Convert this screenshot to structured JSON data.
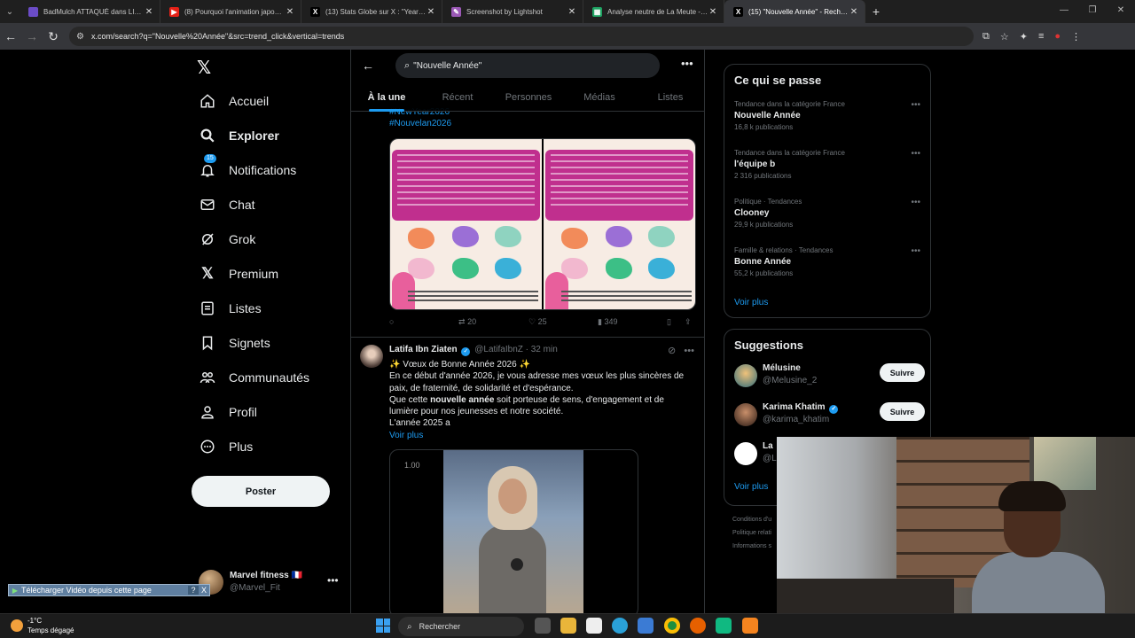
{
  "browser": {
    "tabs": [
      {
        "title": "BadMulch ATTAQUÉ dans LIBÉ",
        "color": "#6b4cc7",
        "glyph": ""
      },
      {
        "title": "(8) Pourquoi l'animation japonaise",
        "color": "#e62117",
        "glyph": "▶"
      },
      {
        "title": "(13) Stats Globe sur X : \"Year W",
        "color": "#000000",
        "glyph": "X"
      },
      {
        "title": "Screenshot by Lightshot",
        "color": "#9b59b6",
        "glyph": "✎"
      },
      {
        "title": "Analyse neutre de La Meute - G",
        "color": "#1ea362",
        "glyph": "▦"
      },
      {
        "title": "(15) \"Nouvelle Année\" - Recherche",
        "color": "#000000",
        "glyph": "X",
        "active": true
      }
    ],
    "new_tab": "+",
    "url": "x.com/search?q=\"Nouvelle%20Année\"&src=trend_click&vertical=trends"
  },
  "nav": {
    "items": [
      {
        "key": "home",
        "label": "Accueil"
      },
      {
        "key": "explore",
        "label": "Explorer"
      },
      {
        "key": "notifications",
        "label": "Notifications",
        "badge": "15"
      },
      {
        "key": "chat",
        "label": "Chat"
      },
      {
        "key": "grok",
        "label": "Grok"
      },
      {
        "key": "premium",
        "label": "Premium"
      },
      {
        "key": "lists",
        "label": "Listes"
      },
      {
        "key": "bookmarks",
        "label": "Signets"
      },
      {
        "key": "communities",
        "label": "Communautés"
      },
      {
        "key": "profile",
        "label": "Profil"
      },
      {
        "key": "more",
        "label": "Plus"
      }
    ],
    "post_label": "Poster",
    "account": {
      "name": "Marvel fitness 🇫🇷",
      "handle": "@Marvel_Fit"
    }
  },
  "search": {
    "query": "\"Nouvelle Année\"",
    "tabs": [
      "À la une",
      "Récent",
      "Personnes",
      "Médias",
      "Listes"
    ]
  },
  "tweet1": {
    "hashtags": [
      "#NewYear2026",
      "#Nouvelan2026"
    ],
    "actions": {
      "retweets": "20",
      "likes": "25",
      "views": "349"
    }
  },
  "tweet2": {
    "name": "Latifa Ibn Ziaten",
    "handle": "@LatifaIbnZ",
    "time": "· 32 min",
    "line1": "✨ Vœux de Bonne Année 2026 ✨",
    "line2": "En ce début d'année 2026, je vous adresse mes vœux les plus sincères de paix, de fraternité, de solidarité et d'espérance.",
    "line3_pre": "Que cette ",
    "line3_bold": "nouvelle année",
    "line3_post": " soit porteuse de sens, d'engagement et de lumière pour nos jeunesses et notre société.",
    "line4": "L'année 2025 a",
    "more": "Voir plus",
    "video_rate": "1.00"
  },
  "trends": {
    "title": "Ce qui se passe",
    "items": [
      {
        "context": "Tendance dans la catégorie France",
        "name": "Nouvelle Année",
        "count": "16,8 k publications"
      },
      {
        "context": "Tendance dans la catégorie France",
        "name": "l'équipe b",
        "count": "2 316 publications"
      },
      {
        "context": "Politique · Tendances",
        "name": "Clooney",
        "count": "29,9 k publications"
      },
      {
        "context": "Famille & relations · Tendances",
        "name": "Bonne Année",
        "count": "55,2 k publications"
      }
    ],
    "show_more": "Voir plus"
  },
  "suggestions": {
    "title": "Suggestions",
    "items": [
      {
        "name": "Mélusine",
        "handle": "@Melusine_2",
        "follow": "Suivre"
      },
      {
        "name": "Karima Khatim",
        "handle": "@karima_khatim",
        "follow": "Suivre"
      },
      {
        "name": "La",
        "handle": "@L"
      }
    ],
    "show_more": "Voir plus"
  },
  "legal": [
    "Conditions d'u",
    "Politique relati",
    "Informations s"
  ],
  "download_bar": {
    "label": "Télécharger Vidéo depuis cette page",
    "help": "?",
    "close": "X"
  },
  "taskbar": {
    "temp": "-1°C",
    "weather": "Temps dégagé",
    "search": "Rechercher"
  },
  "colors": {
    "accent": "#1d9bf0",
    "background": "#000000",
    "border": "#2f3336",
    "muted": "#71767b"
  }
}
